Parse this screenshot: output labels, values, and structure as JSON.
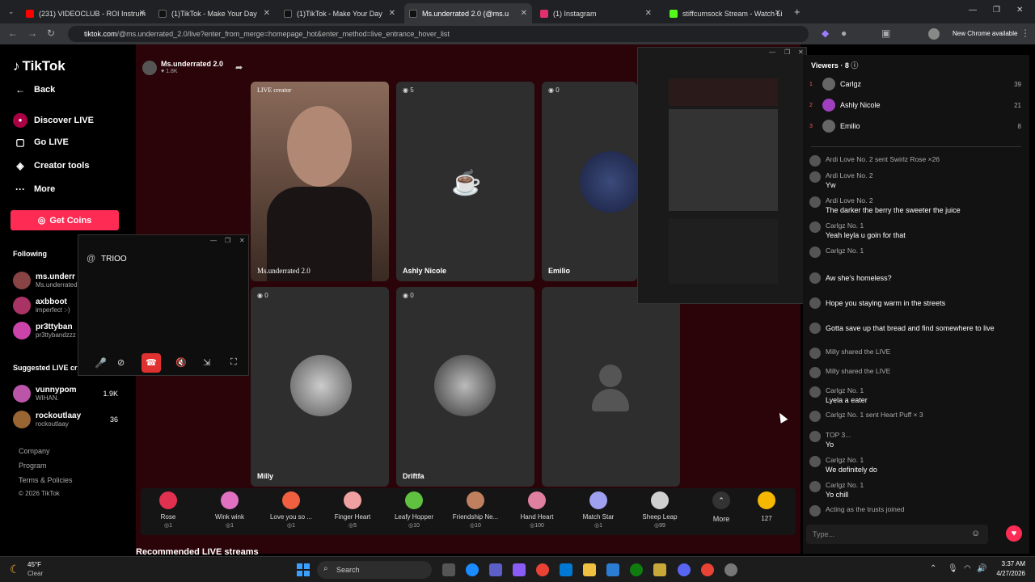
{
  "tabs": [
    {
      "label": "(231) VIDEOCLUB - ROI Instrum",
      "color": "#ff0000"
    },
    {
      "label": "(1)TikTok - Make Your Day",
      "color": "#111"
    },
    {
      "label": "(1)TikTok - Make Your Day",
      "color": "#111"
    },
    {
      "label": "Ms.underrated 2.0 (@ms.u",
      "color": "#111"
    },
    {
      "label": "(1) Instagram",
      "color": "#e1306c"
    },
    {
      "label": "stiffcumsock Stream - Watch Li",
      "color": "#53fc18"
    }
  ],
  "address": {
    "host": "tiktok.com",
    "path": "/@ms.underrated_2.0/live?enter_from_merge=homepage_hot&enter_method=live_entrance_hover_list",
    "new_chrome": "New Chrome available"
  },
  "sidebar": {
    "logo": "TikTok",
    "back": "Back",
    "nav": [
      {
        "label": "Discover LIVE",
        "icon": "live-icon"
      },
      {
        "label": "Go LIVE",
        "icon": "camera-icon"
      },
      {
        "label": "Creator tools",
        "icon": "tools-icon"
      },
      {
        "label": "More",
        "icon": "more-icon"
      }
    ],
    "get_coins": "Get Coins",
    "following_title": "Following",
    "following": [
      {
        "name": "ms.underr",
        "sub": "Ms.underrated"
      },
      {
        "name": "axbboot",
        "sub": "imperfect :-)"
      },
      {
        "name": "pr3ttyban",
        "sub": "pr3ttybandzzz"
      }
    ],
    "suggested_title": "Suggested LIVE cr",
    "suggested": [
      {
        "name": "vunnypom",
        "sub": "WIHAN.",
        "count": "1.9K"
      },
      {
        "name": "rockoutlaay",
        "sub": "rockoutlaay",
        "count": "36"
      }
    ],
    "footer": [
      "Company",
      "Program",
      "Terms & Policies",
      "© 2026 TikTok"
    ]
  },
  "host": {
    "name": "Ms.underrated 2.0",
    "likes": "1.8K"
  },
  "grid": [
    {
      "label": "Ms.underrated 2.0",
      "tag": "LIVE creator",
      "count": ""
    },
    {
      "label": "Ashly Nicole",
      "tag": "",
      "count": "5"
    },
    {
      "label": "Emilio",
      "tag": "",
      "count": "0"
    },
    {
      "label": "Milly",
      "tag": "",
      "count": "0"
    },
    {
      "label": "Driftfa",
      "tag": "",
      "count": "0"
    },
    {
      "label": "",
      "tag": "",
      "count": ""
    }
  ],
  "popup": {
    "title": "TRIOO"
  },
  "gifts": [
    {
      "name": "Rose",
      "price": "1",
      "color": "#e03150"
    },
    {
      "name": "Wink wink",
      "price": "1",
      "color": "#e070c0"
    },
    {
      "name": "Love you so ...",
      "price": "1",
      "color": "#f06040"
    },
    {
      "name": "Finger Heart",
      "price": "5",
      "color": "#f0a0a0"
    },
    {
      "name": "Leafy Hopper",
      "price": "10",
      "color": "#60c040"
    },
    {
      "name": "Friendship Ne...",
      "price": "10",
      "color": "#c08060"
    },
    {
      "name": "Hand Heart",
      "price": "100",
      "color": "#e080a0"
    },
    {
      "name": "Match Star",
      "price": "1",
      "color": "#a0a0f0"
    },
    {
      "name": "Sheep Leap",
      "price": "99",
      "color": "#d0d0d0"
    }
  ],
  "gift_more": "More",
  "coin_count": "127",
  "recommended": "Recommended LIVE streams",
  "viewers": {
    "title": "Viewers · 8",
    "list": [
      {
        "rank": "1",
        "name": "Carlgz",
        "score": "39"
      },
      {
        "rank": "2",
        "name": "Ashly Nicole",
        "score": "21"
      },
      {
        "rank": "3",
        "name": "Emilio",
        "score": "8"
      }
    ]
  },
  "chat": [
    {
      "user": "Ardi Love  No. 2  sent Swirlz  Rose  ×26",
      "text": ""
    },
    {
      "user": "Ardi Love  No. 2",
      "text": "Yw"
    },
    {
      "user": "Ardi Love  No. 2",
      "text": "The darker the berry the sweeter the juice"
    },
    {
      "user": "Carlgz  No. 1",
      "text": "Yeah leyla u goin for that"
    },
    {
      "user": "Carlgz  No. 1",
      "text": ""
    },
    {
      "user": "",
      "text": "Aw she's homeless?"
    },
    {
      "user": "",
      "text": "Hope you staying warm in the streets"
    },
    {
      "user": "",
      "text": "Gotta save up that bread and find somewhere to live"
    },
    {
      "user": "Milly  shared the LIVE",
      "text": ""
    },
    {
      "user": "Milly  shared the LIVE",
      "text": ""
    },
    {
      "user": "Carlgz  No. 1",
      "text": "Lyela a eater"
    },
    {
      "user": "Carlgz  No. 1  sent Heart Puff  × 3",
      "text": ""
    },
    {
      "user": "TOP 3...",
      "text": "Yo"
    },
    {
      "user": "Carlgz  No. 1",
      "text": "We definitely do"
    },
    {
      "user": "Carlgz  No. 1",
      "text": "Yo chill"
    },
    {
      "user": "Acting as the trusts  joined",
      "text": ""
    }
  ],
  "chat_placeholder": "Type...",
  "taskbar": {
    "weather_temp": "45°F",
    "weather_desc": "Clear",
    "search": "Search",
    "time": "3:37 AM",
    "date": "4/27/2026"
  }
}
